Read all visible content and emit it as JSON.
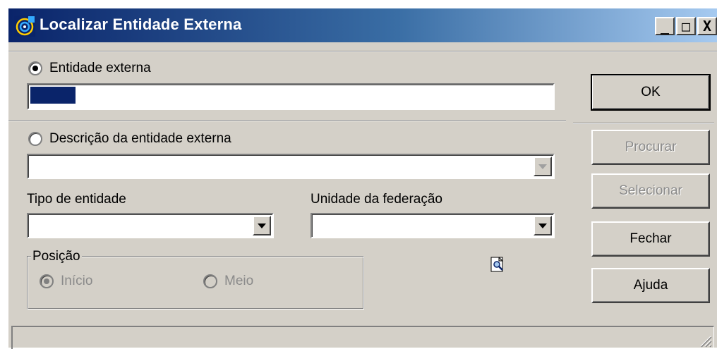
{
  "window": {
    "title": "Localizar Entidade Externa",
    "icon": "spiral-app-icon"
  },
  "caption_buttons": {
    "minimize": "_",
    "maximize": "□",
    "close": "X"
  },
  "search_by_code": {
    "label": "Entidade externa",
    "selected": true,
    "value": ""
  },
  "search_by_description": {
    "label": "Descrição da entidade externa",
    "selected": false,
    "value": ""
  },
  "tipo_entidade": {
    "label": "Tipo de entidade",
    "value": ""
  },
  "unidade_federacao": {
    "label": "Unidade da federação",
    "value": ""
  },
  "posicao": {
    "legend": "Posição",
    "options": [
      "Início",
      "Meio"
    ],
    "selected": "Início",
    "enabled": false
  },
  "buttons": {
    "ok": "OK",
    "procurar": "Procurar",
    "selecionar": "Selecionar",
    "fechar": "Fechar",
    "ajuda": "Ajuda"
  },
  "status_bar": {
    "text": ""
  },
  "colors": {
    "title_gradient_start": "#0a246a",
    "title_gradient_end": "#a6caf0",
    "face": "#d4d0c8",
    "disabled_text": "#8a8a8a"
  }
}
